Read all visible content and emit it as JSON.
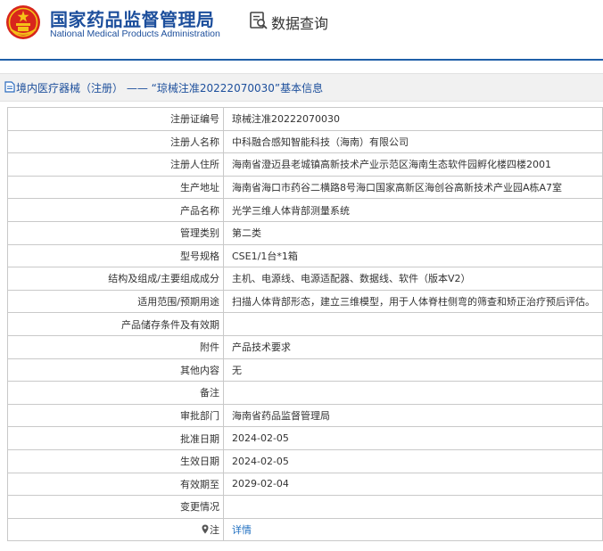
{
  "header": {
    "org_name_cn": "国家药品监督管理局",
    "org_name_en": "National Medical Products Administration",
    "section_title": "数据查询"
  },
  "title_bar": {
    "category": "境内医疗器械（注册）",
    "separator": "——",
    "record_title": "“琼械注准20222070030”基本信息"
  },
  "rows": [
    {
      "label": "注册证编号",
      "value": "琼械注准20222070030"
    },
    {
      "label": "注册人名称",
      "value": "中科融合感知智能科技（海南）有限公司"
    },
    {
      "label": "注册人住所",
      "value": "海南省澄迈县老城镇高新技术产业示范区海南生态软件园孵化楼四楼2001"
    },
    {
      "label": "生产地址",
      "value": "海南省海口市药谷二横路8号海口国家高新区海创谷高新技术产业园A栋A7室"
    },
    {
      "label": "产品名称",
      "value": "光学三维人体背部测量系统"
    },
    {
      "label": "管理类别",
      "value": "第二类"
    },
    {
      "label": "型号规格",
      "value": "CSE1/1台*1箱"
    },
    {
      "label": "结构及组成/主要组成成分",
      "value": "主机、电源线、电源适配器、数据线、软件（版本V2）"
    },
    {
      "label": "适用范围/预期用途",
      "value": "扫描人体背部形态，建立三维模型，用于人体脊柱侧弯的筛查和矫正治疗预后评估。"
    },
    {
      "label": "产品储存条件及有效期",
      "value": ""
    },
    {
      "label": "附件",
      "value": "产品技术要求"
    },
    {
      "label": "其他内容",
      "value": "无"
    },
    {
      "label": "备注",
      "value": ""
    },
    {
      "label": "审批部门",
      "value": "海南省药品监督管理局"
    },
    {
      "label": "批准日期",
      "value": "2024-02-05"
    },
    {
      "label": "生效日期",
      "value": "2024-02-05"
    },
    {
      "label": "有效期至",
      "value": "2029-02-04"
    },
    {
      "label": "变更情况",
      "value": ""
    }
  ],
  "note_row": {
    "label": "注",
    "link_text": "详情"
  },
  "colors": {
    "brand_blue": "#1d4f9c",
    "link_blue": "#1f6fc0",
    "emblem_red": "#d8261c",
    "emblem_gold": "#f5c218"
  },
  "icons": {
    "emblem": "national-emblem-icon",
    "query": "data-query-icon",
    "title": "document-icon",
    "note": "map-pin-icon"
  }
}
